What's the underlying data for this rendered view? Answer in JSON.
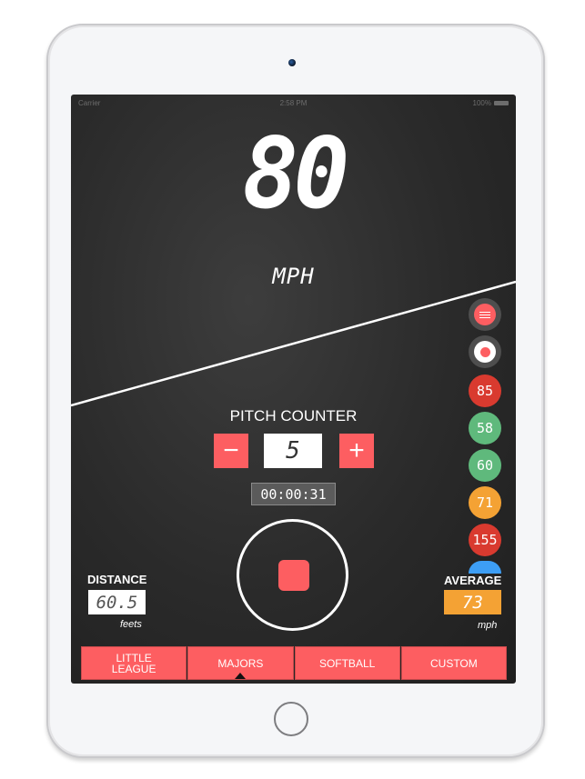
{
  "status_bar": {
    "carrier": "Carrier",
    "time": "2:58 PM",
    "battery": "100%"
  },
  "speed": {
    "value": "80",
    "unit": "MPH"
  },
  "pitch_counter": {
    "title": "PITCH COUNTER",
    "decrement_label": "−",
    "increment_label": "+",
    "count": "5",
    "timer": "00:00:31"
  },
  "history": [
    {
      "value": "85",
      "color": "#d93a2f"
    },
    {
      "value": "58",
      "color": "#5fb97c"
    },
    {
      "value": "60",
      "color": "#5fb97c"
    },
    {
      "value": "71",
      "color": "#f4a234"
    },
    {
      "value": "155",
      "color": "#d93a2f"
    },
    {
      "value": "",
      "color": "#3d9ef5"
    }
  ],
  "side_buttons": {
    "menu_icon": "hamburger-menu-icon",
    "record_icon": "record-icon"
  },
  "distance": {
    "label": "DISTANCE",
    "value": "60.5",
    "unit": "feets"
  },
  "average": {
    "label": "AVERAGE",
    "value": "73",
    "unit": "mph",
    "color": "#f4a234"
  },
  "tabs": [
    {
      "label": "LITTLE\nLEAGUE",
      "selected": false
    },
    {
      "label": "MAJORS",
      "selected": true
    },
    {
      "label": "SOFTBALL",
      "selected": false
    },
    {
      "label": "CUSTOM",
      "selected": false
    }
  ],
  "colors": {
    "accent": "#fd5e61",
    "background": "#2a2a2a"
  }
}
